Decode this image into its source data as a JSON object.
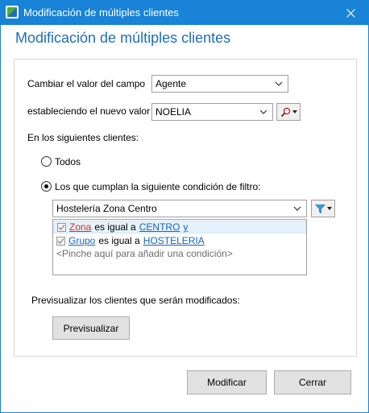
{
  "window": {
    "title": "Modificación de múltiples clientes"
  },
  "heading": "Modificación de múltiples clientes",
  "form": {
    "change_field_label": "Cambiar el valor del campo",
    "field_value": "Agente",
    "new_value_label": "estableciendo el nuevo valor",
    "new_value": "NOELIA",
    "clients_label": "En los siguientes clientes:",
    "radio_all": "Todos",
    "radio_filter": "Los que cumplan la siguiente condición de filtro:",
    "filter_value": "Hostelería Zona Centro",
    "conditions": [
      {
        "field": "Zona",
        "op": "es igual a",
        "value": "CENTRO",
        "conj": "y"
      },
      {
        "field": "Grupo",
        "op": "es igual a",
        "value": "HOSTELERIA"
      }
    ],
    "add_condition": "<Pinche aquí para añadir una condición>",
    "preview_label": "Previsualizar los clientes que serán modificados:",
    "preview_button": "Previsualizar"
  },
  "footer": {
    "modify_button": "Modificar",
    "close_button": "Cerrar"
  },
  "colors": {
    "titlebar": "#1883d7",
    "heading": "#1e6fb8",
    "field_link": "#d32f2f",
    "value_link": "#1565c0"
  }
}
